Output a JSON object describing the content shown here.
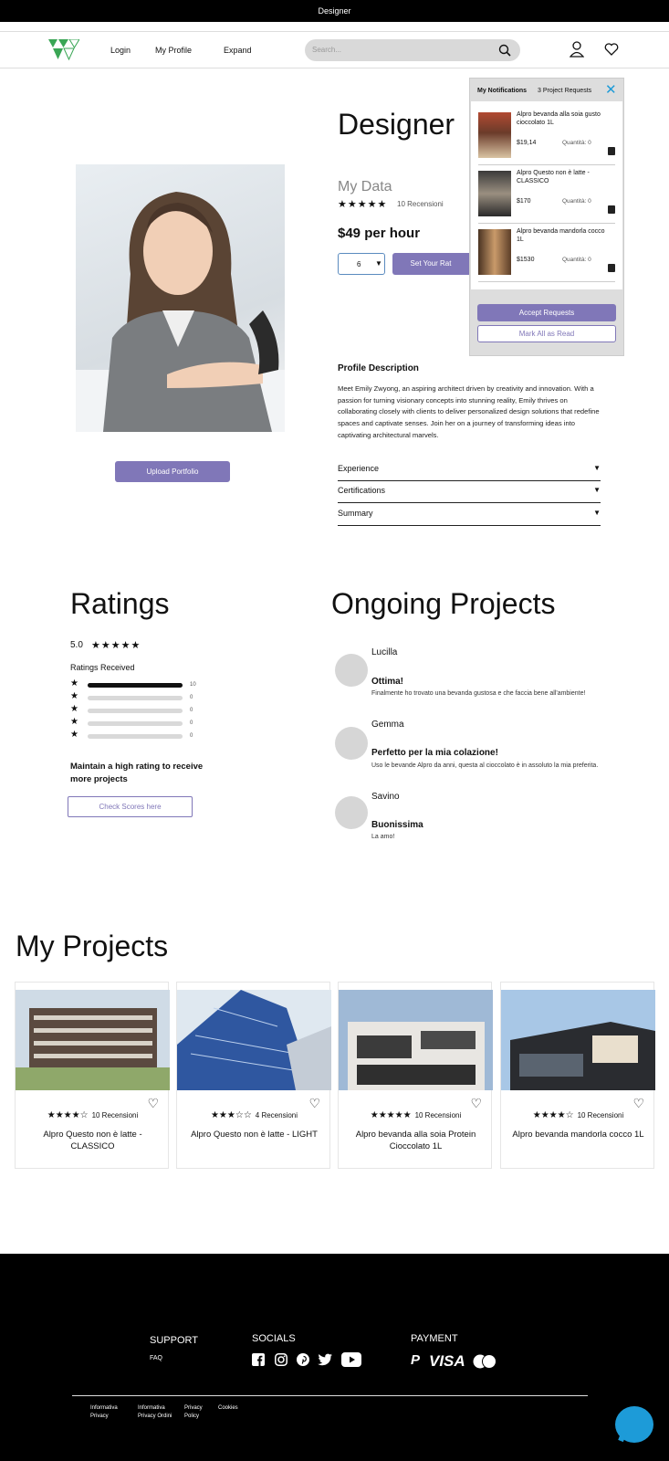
{
  "topbar": {
    "title": "Designer"
  },
  "nav": {
    "login": "Login",
    "my_profile": "My Profile",
    "expand": "Expand",
    "search_placeholder": "Search..."
  },
  "hero": {
    "heading": "Designer",
    "data_label": "My  Data",
    "stars": "★★★★★",
    "reviews": "10 Recensioni",
    "price": "$49 per hour",
    "quantity": "6",
    "set_rate_button": "Set Your Rat",
    "upload_button": "Upload Portfolio",
    "profile_desc_title": "Profile Description",
    "profile_desc": "Meet Emily Zwyong, an aspiring architect driven by creativity and innovation. With a passion for turning visionary concepts into stunning reality, Emily thrives on collaborating closely with clients to deliver personalized design solutions that redefine spaces and captivate senses. Join her on a journey of transforming ideas into captivating architectural marvels.",
    "accordion": [
      {
        "label": "Experience"
      },
      {
        "label": "Certifications"
      },
      {
        "label": "Summary"
      }
    ]
  },
  "notifications": {
    "title": "My Notifications",
    "count": "3 Project Requests",
    "items": [
      {
        "title": "Alpro bevanda alla soia gusto cioccolato 1L",
        "price": "$19,14",
        "qty": "Quantità: 0"
      },
      {
        "title": "Alpro Questo non è latte - CLASSICO",
        "price": "$170",
        "qty": "Quantità: 0"
      },
      {
        "title": "Alpro bevanda mandorla cocco 1L",
        "price": "$1530",
        "qty": "Quantità: 0"
      }
    ],
    "accept_button": "Accept Requests",
    "mark_read_button": "Mark All as Read"
  },
  "ratings": {
    "title": "Ratings",
    "score": "5.0",
    "stars": "★★★★★",
    "received_label": "Ratings Received",
    "bars": [
      {
        "count": "10",
        "fill": 1.0
      },
      {
        "count": "0",
        "fill": 0
      },
      {
        "count": "0",
        "fill": 0
      },
      {
        "count": "0",
        "fill": 0
      },
      {
        "count": "0",
        "fill": 0
      }
    ],
    "cta_text": "Maintain a high rating to receive more projects",
    "check_button": "Check Scores here"
  },
  "ongoing": {
    "title": "Ongoing Projects",
    "items": [
      {
        "name": "Lucilla",
        "title": "Ottima!",
        "text": "Finalmente ho trovato una bevanda gustosa e che faccia bene all'ambiente!"
      },
      {
        "name": "Gemma",
        "title": "Perfetto per la mia colazione!",
        "text": "Uso le bevande Alpro da anni, questa al cioccolato è in assoluto la mia preferita."
      },
      {
        "name": "Savino",
        "title": "Buonissima",
        "text": "La amo!"
      }
    ]
  },
  "projects": {
    "title": "My Projects",
    "cards": [
      {
        "stars": "★★★★☆",
        "reviews": "10 Recensioni",
        "title": "Alpro Questo non è latte - CLASSICO"
      },
      {
        "stars": "★★★☆☆",
        "reviews": "4 Recensioni",
        "title": "Alpro Questo non è latte - LIGHT"
      },
      {
        "stars": "★★★★★",
        "reviews": "10 Recensioni",
        "title": "Alpro bevanda alla soia Protein Cioccolato 1L"
      },
      {
        "stars": "★★★★☆",
        "reviews": "10 Recensioni",
        "title": "Alpro bevanda mandorla cocco 1L"
      }
    ]
  },
  "footer": {
    "support": "SUPPORT",
    "faq": "FAQ",
    "socials": "SOCIALS",
    "payment": "PAYMENT",
    "visa": "VISA",
    "links": [
      "Informativa Privacy",
      "Informativa Privacy Ordini",
      "Privacy Policy",
      "Cookies"
    ]
  },
  "colors": {
    "accent": "#8077b8",
    "logo_green": "#3aa655",
    "chat": "#1d9bd8"
  }
}
